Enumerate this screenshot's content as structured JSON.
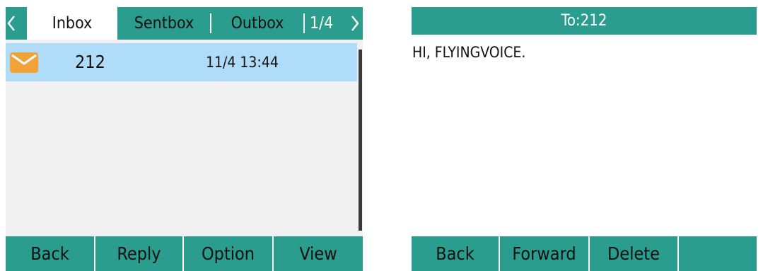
{
  "inbox_screen": {
    "tabs": [
      {
        "label": "Inbox",
        "active": true
      },
      {
        "label": "Sentbox",
        "active": false
      },
      {
        "label": "Outbox",
        "active": false
      }
    ],
    "page_indicator": "1/4",
    "messages": [
      {
        "number": "212",
        "time": "11/4 13:44",
        "icon": "mail-icon",
        "selected": true
      }
    ],
    "softkeys": [
      "Back",
      "Reply",
      "Option",
      "View"
    ]
  },
  "message_screen": {
    "title": "To:212",
    "body": "HI, FLYINGVOICE.",
    "softkeys": [
      "Back",
      "Forward",
      "Delete",
      ""
    ]
  },
  "colors": {
    "accent": "#2a9d8f",
    "selected_row": "#aedcf9",
    "list_bg": "#f1f1f1",
    "mail_icon": "#f2a338",
    "text": "#111111"
  }
}
